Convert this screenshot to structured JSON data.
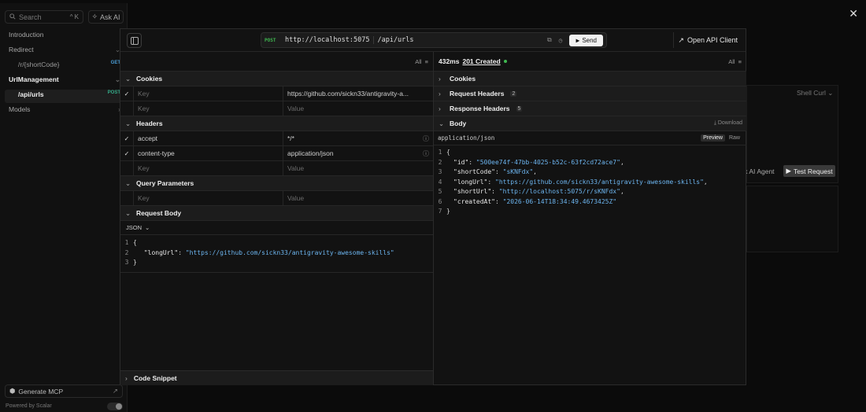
{
  "sidebar": {
    "search_placeholder": "Search",
    "search_kbd": "^ K",
    "ask_ai": "Ask AI",
    "items": [
      {
        "label": "Introduction"
      },
      {
        "label": "Redirect"
      },
      {
        "label": "/r/{shortCode}",
        "tag": "GET"
      },
      {
        "label": "UrlManagement"
      },
      {
        "label": "/api/urls",
        "tag": "POST"
      },
      {
        "label": "Models"
      }
    ],
    "generate_mcp": "Generate MCP",
    "powered_by": "Powered by Scalar"
  },
  "background": {
    "shell": "Shell Curl",
    "ask_agent": "Ask AI Agent",
    "test_request": "Test Request",
    "ask_agent_partial": "sk AI Agent"
  },
  "topbar": {
    "method": "POST",
    "host": "http://localhost:5075",
    "path": "/api/urls",
    "send": "Send",
    "open_client": "Open API Client"
  },
  "request": {
    "filter": "All",
    "cookies": {
      "title": "Cookies",
      "rows": [
        {
          "key": "Key",
          "value": "https://github.com/sickn33/antigravity-a...",
          "checked": true,
          "key_placeholder": true
        },
        {
          "key": "Key",
          "value": "Value",
          "checked": false,
          "key_placeholder": true,
          "value_placeholder": true
        }
      ]
    },
    "headers": {
      "title": "Headers",
      "rows": [
        {
          "key": "accept",
          "value": "*/*",
          "checked": true
        },
        {
          "key": "content-type",
          "value": "application/json",
          "checked": true
        },
        {
          "key": "Key",
          "value": "Value",
          "checked": false,
          "placeholder": true
        }
      ]
    },
    "query": {
      "title": "Query Parameters",
      "row": {
        "key": "Key",
        "value": "Value"
      }
    },
    "body": {
      "title": "Request Body",
      "format": "JSON",
      "lines": [
        {
          "n": "1",
          "text": "{"
        },
        {
          "n": "2",
          "key": "\"longUrl\"",
          "value": "\"https://github.com/sickn33/antigravity-awesome-skills\""
        },
        {
          "n": "3",
          "text": "}"
        }
      ]
    },
    "snippet_title": "Code Snippet"
  },
  "response": {
    "time": "432ms",
    "status": "201 Created",
    "status_color": "#3fb950",
    "filter": "All",
    "sections": [
      {
        "title": "Cookies"
      },
      {
        "title": "Request Headers",
        "count": "2"
      },
      {
        "title": "Response Headers",
        "count": "5"
      }
    ],
    "body": {
      "title": "Body",
      "download": "Download",
      "content_type": "application/json",
      "tab_preview": "Preview",
      "tab_raw": "Raw",
      "lines": [
        {
          "n": "1",
          "text": "{"
        },
        {
          "n": "2",
          "key": "\"id\"",
          "value": "\"500ee74f-47bb-4025-b52c-63f2cd72ace7\"",
          "comma": ","
        },
        {
          "n": "3",
          "key": "\"shortCode\"",
          "value": "\"sKNFdx\"",
          "comma": ","
        },
        {
          "n": "4",
          "key": "\"longUrl\"",
          "value": "\"https://github.com/sickn33/antigravity-awesome-skills\"",
          "comma": ","
        },
        {
          "n": "5",
          "key": "\"shortUrl\"",
          "value": "\"http://localhost:5075/r/sKNFdx\"",
          "comma": ","
        },
        {
          "n": "6",
          "key": "\"createdAt\"",
          "value": "\"2026-06-14T18:34:49.4673425Z\"",
          "comma": ""
        },
        {
          "n": "7",
          "text": "}"
        }
      ]
    }
  }
}
